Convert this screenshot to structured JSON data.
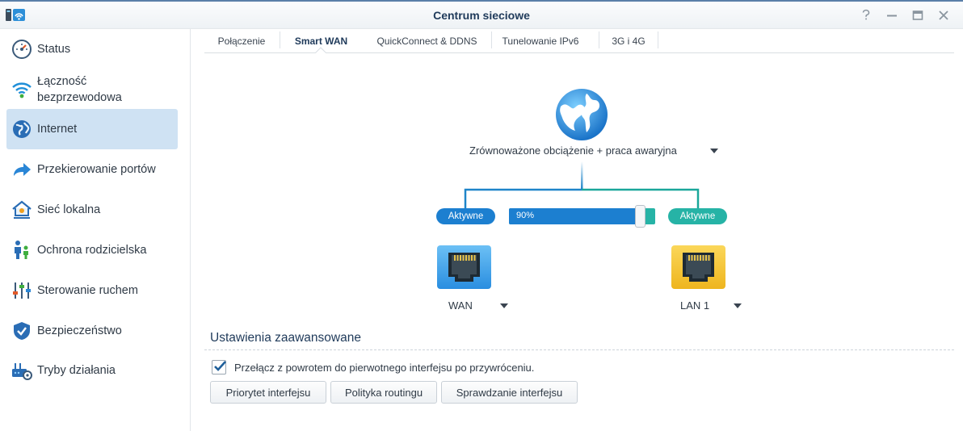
{
  "window": {
    "title": "Centrum sieciowe",
    "controls": [
      "help-icon",
      "minimize-icon",
      "maximize-icon",
      "close-icon"
    ]
  },
  "sidebar": {
    "items": [
      {
        "label": "Status",
        "icon": "gauge-icon",
        "active": false
      },
      {
        "label": "Łączność bezprzewodowa",
        "icon": "wifi-icon",
        "active": false
      },
      {
        "label": "Internet",
        "icon": "globe-icon",
        "active": true
      },
      {
        "label": "Przekierowanie portów",
        "icon": "forward-arrow-icon",
        "active": false
      },
      {
        "label": "Sieć lokalna",
        "icon": "home-network-icon",
        "active": false
      },
      {
        "label": "Ochrona rodzicielska",
        "icon": "family-icon",
        "active": false
      },
      {
        "label": "Sterowanie ruchem",
        "icon": "sliders-icon",
        "active": false
      },
      {
        "label": "Bezpieczeństwo",
        "icon": "shield-icon",
        "active": false
      },
      {
        "label": "Tryby działania",
        "icon": "router-gear-icon",
        "active": false
      }
    ]
  },
  "tabs": [
    {
      "label": "Połączenie",
      "active": false
    },
    {
      "label": "Smart WAN",
      "active": true
    },
    {
      "label": "QuickConnect & DDNS",
      "active": false
    },
    {
      "label": "Tunelowanie IPv6",
      "active": false
    },
    {
      "label": "3G i 4G",
      "active": false
    }
  ],
  "smart_wan": {
    "mode": "Zrównoważone obciążenie + praca awaryjna",
    "left_status": "Aktywne",
    "right_status": "Aktywne",
    "balance_label": "90%",
    "balance_fraction": 0.9,
    "left_interface": "WAN",
    "right_interface": "LAN 1"
  },
  "advanced": {
    "title": "Ustawienia zaawansowane",
    "failback_label": "Przełącz z powrotem do pierwotnego interfejsu po przywróceniu.",
    "failback_checked": true,
    "buttons": [
      "Priorytet interfejsu",
      "Polityka routingu",
      "Sprawdzanie interfejsu"
    ]
  },
  "colors": {
    "accent_blue": "#1c7fd0",
    "accent_teal": "#26b3a6",
    "active_nav": "#cfe2f3",
    "wan_port": "#3d9ee8",
    "lan_port": "#f2c230"
  }
}
